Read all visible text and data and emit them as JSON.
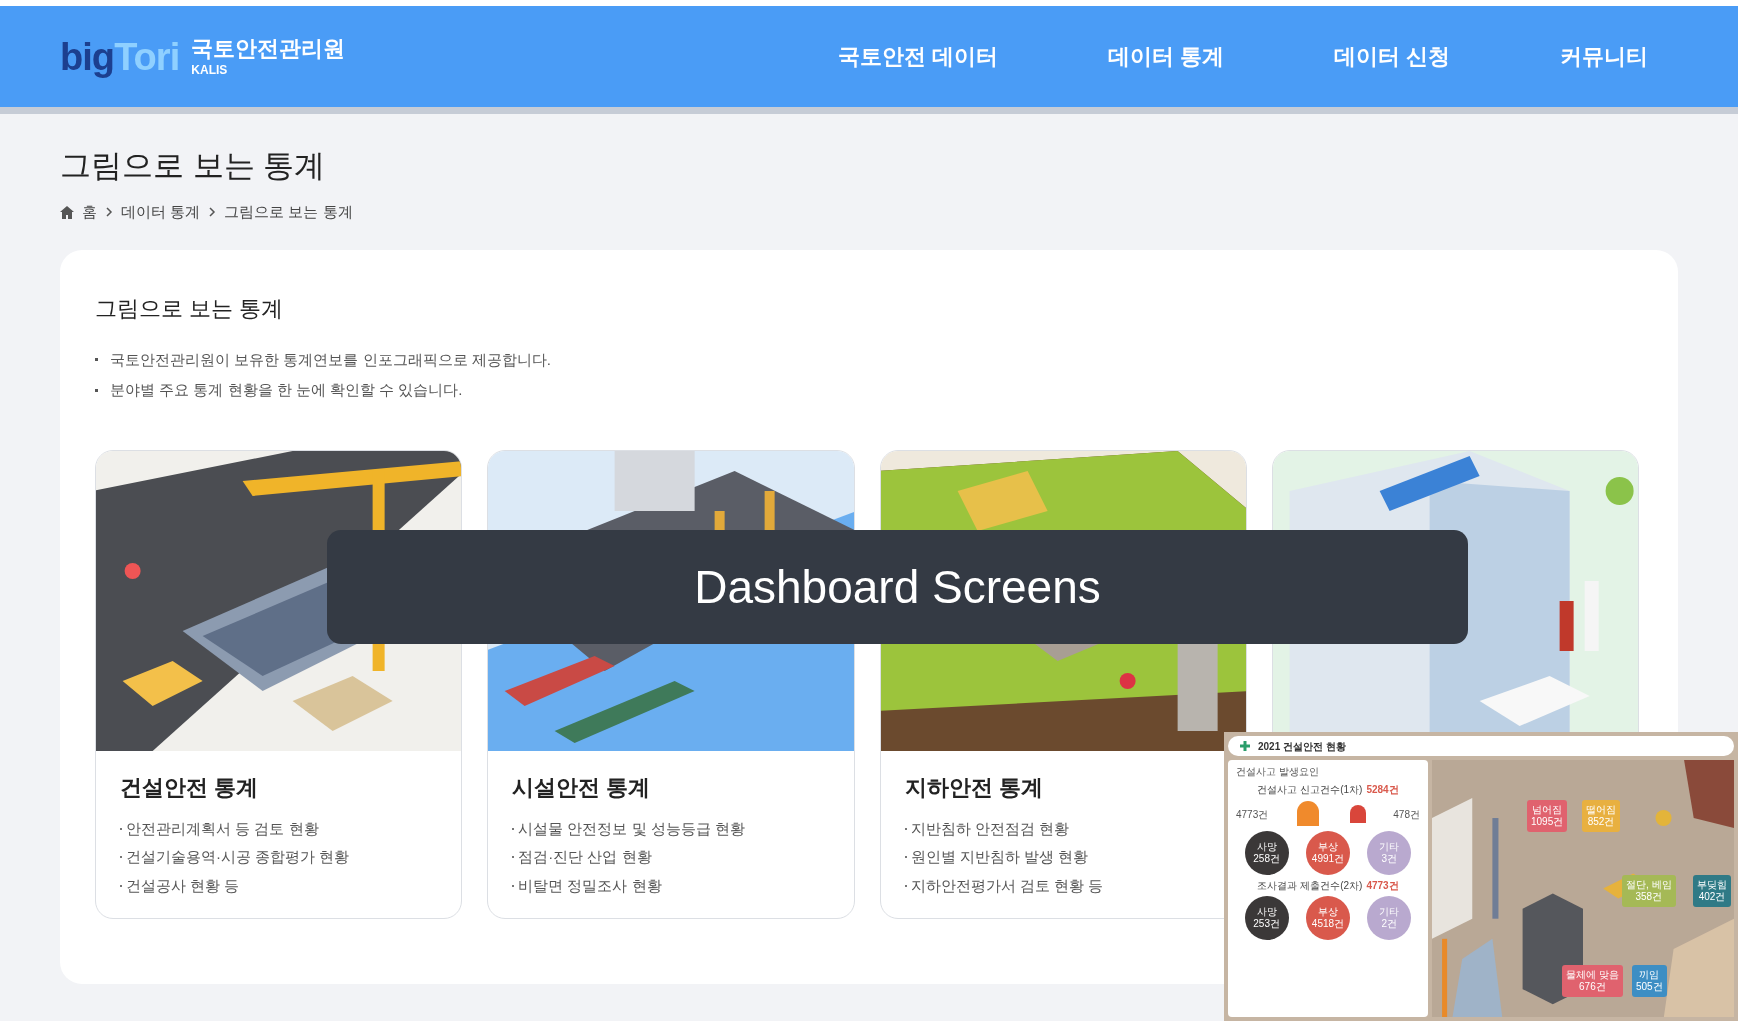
{
  "header": {
    "logo": {
      "part_1": "big",
      "part_2": "Tori",
      "org_name": "국토안전관리원",
      "org_abbr": "KALIS"
    },
    "nav": [
      "국토안전 데이터",
      "데이터 통계",
      "데이터 신청",
      "커뮤니티"
    ]
  },
  "page_title": "그림으로 보는 통계",
  "breadcrumb": [
    "홈",
    "데이터 통계",
    "그림으로 보는 통계"
  ],
  "section": {
    "title": "그림으로 보는 통계",
    "bullets": [
      "국토안전관리원이 보유한 통계연보를 인포그래픽으로 제공합니다.",
      "분야별 주요 통계 현황을 한 눈에 확인할 수 있습니다."
    ]
  },
  "cards": [
    {
      "kind": "construction",
      "title": "건설안전 통계",
      "items": [
        "안전관리계획서 등 검토 현황",
        "건설기술용역·시공 종합평가 현황",
        "건설공사 현황 등"
      ]
    },
    {
      "kind": "facility",
      "title": "시설안전 통계",
      "items": [
        "시설물 안전정보 및 성능등급 현황",
        "점검·진단 산업 현황",
        "비탈면 정밀조사 현황"
      ]
    },
    {
      "kind": "underground",
      "title": "지하안전 통계",
      "items": [
        "지반침하 안전점검 현황",
        "원인별 지반침하 발생 현황",
        "지하안전평가서 검토 현황 등"
      ]
    },
    {
      "kind": "hospital"
    }
  ],
  "banner": "Dashboard Screens",
  "inset": {
    "title": "2021 건설안전 현황",
    "panel_title": "건설사고 발생요인",
    "first_heading": "건설사고 신고건수(1차)",
    "first_total": "5284건",
    "left_count": "4773건",
    "right_count": "478건",
    "first_row": [
      {
        "label": "사망",
        "count": "258건",
        "color": "#3b3838"
      },
      {
        "label": "부상",
        "count": "4991건",
        "color": "#d9594c"
      },
      {
        "label": "기타",
        "count": "3건",
        "color": "#b9a9cf"
      }
    ],
    "second_heading": "조사결과 제출건수(2차)",
    "second_total": "4773건",
    "second_row": [
      {
        "label": "사망",
        "count": "253건",
        "color": "#3b3838"
      },
      {
        "label": "부상",
        "count": "4518건",
        "color": "#d9594c"
      },
      {
        "label": "기타",
        "count": "2건",
        "color": "#b9a9cf"
      }
    ],
    "tags": [
      {
        "label": "넘어짐",
        "count": "1095건",
        "color": "#e0626e"
      },
      {
        "label": "떨어짐",
        "count": "852건",
        "color": "#e8b040"
      },
      {
        "label": "절단, 베임",
        "count": "358건",
        "color": "#a5b956"
      },
      {
        "label": "부딪힘",
        "count": "402건",
        "color": "#2f7a86"
      },
      {
        "label": "물체에 맞음",
        "count": "676건",
        "color": "#e0626e"
      },
      {
        "label": "끼임",
        "count": "505건",
        "color": "#3d8ec4"
      }
    ]
  }
}
